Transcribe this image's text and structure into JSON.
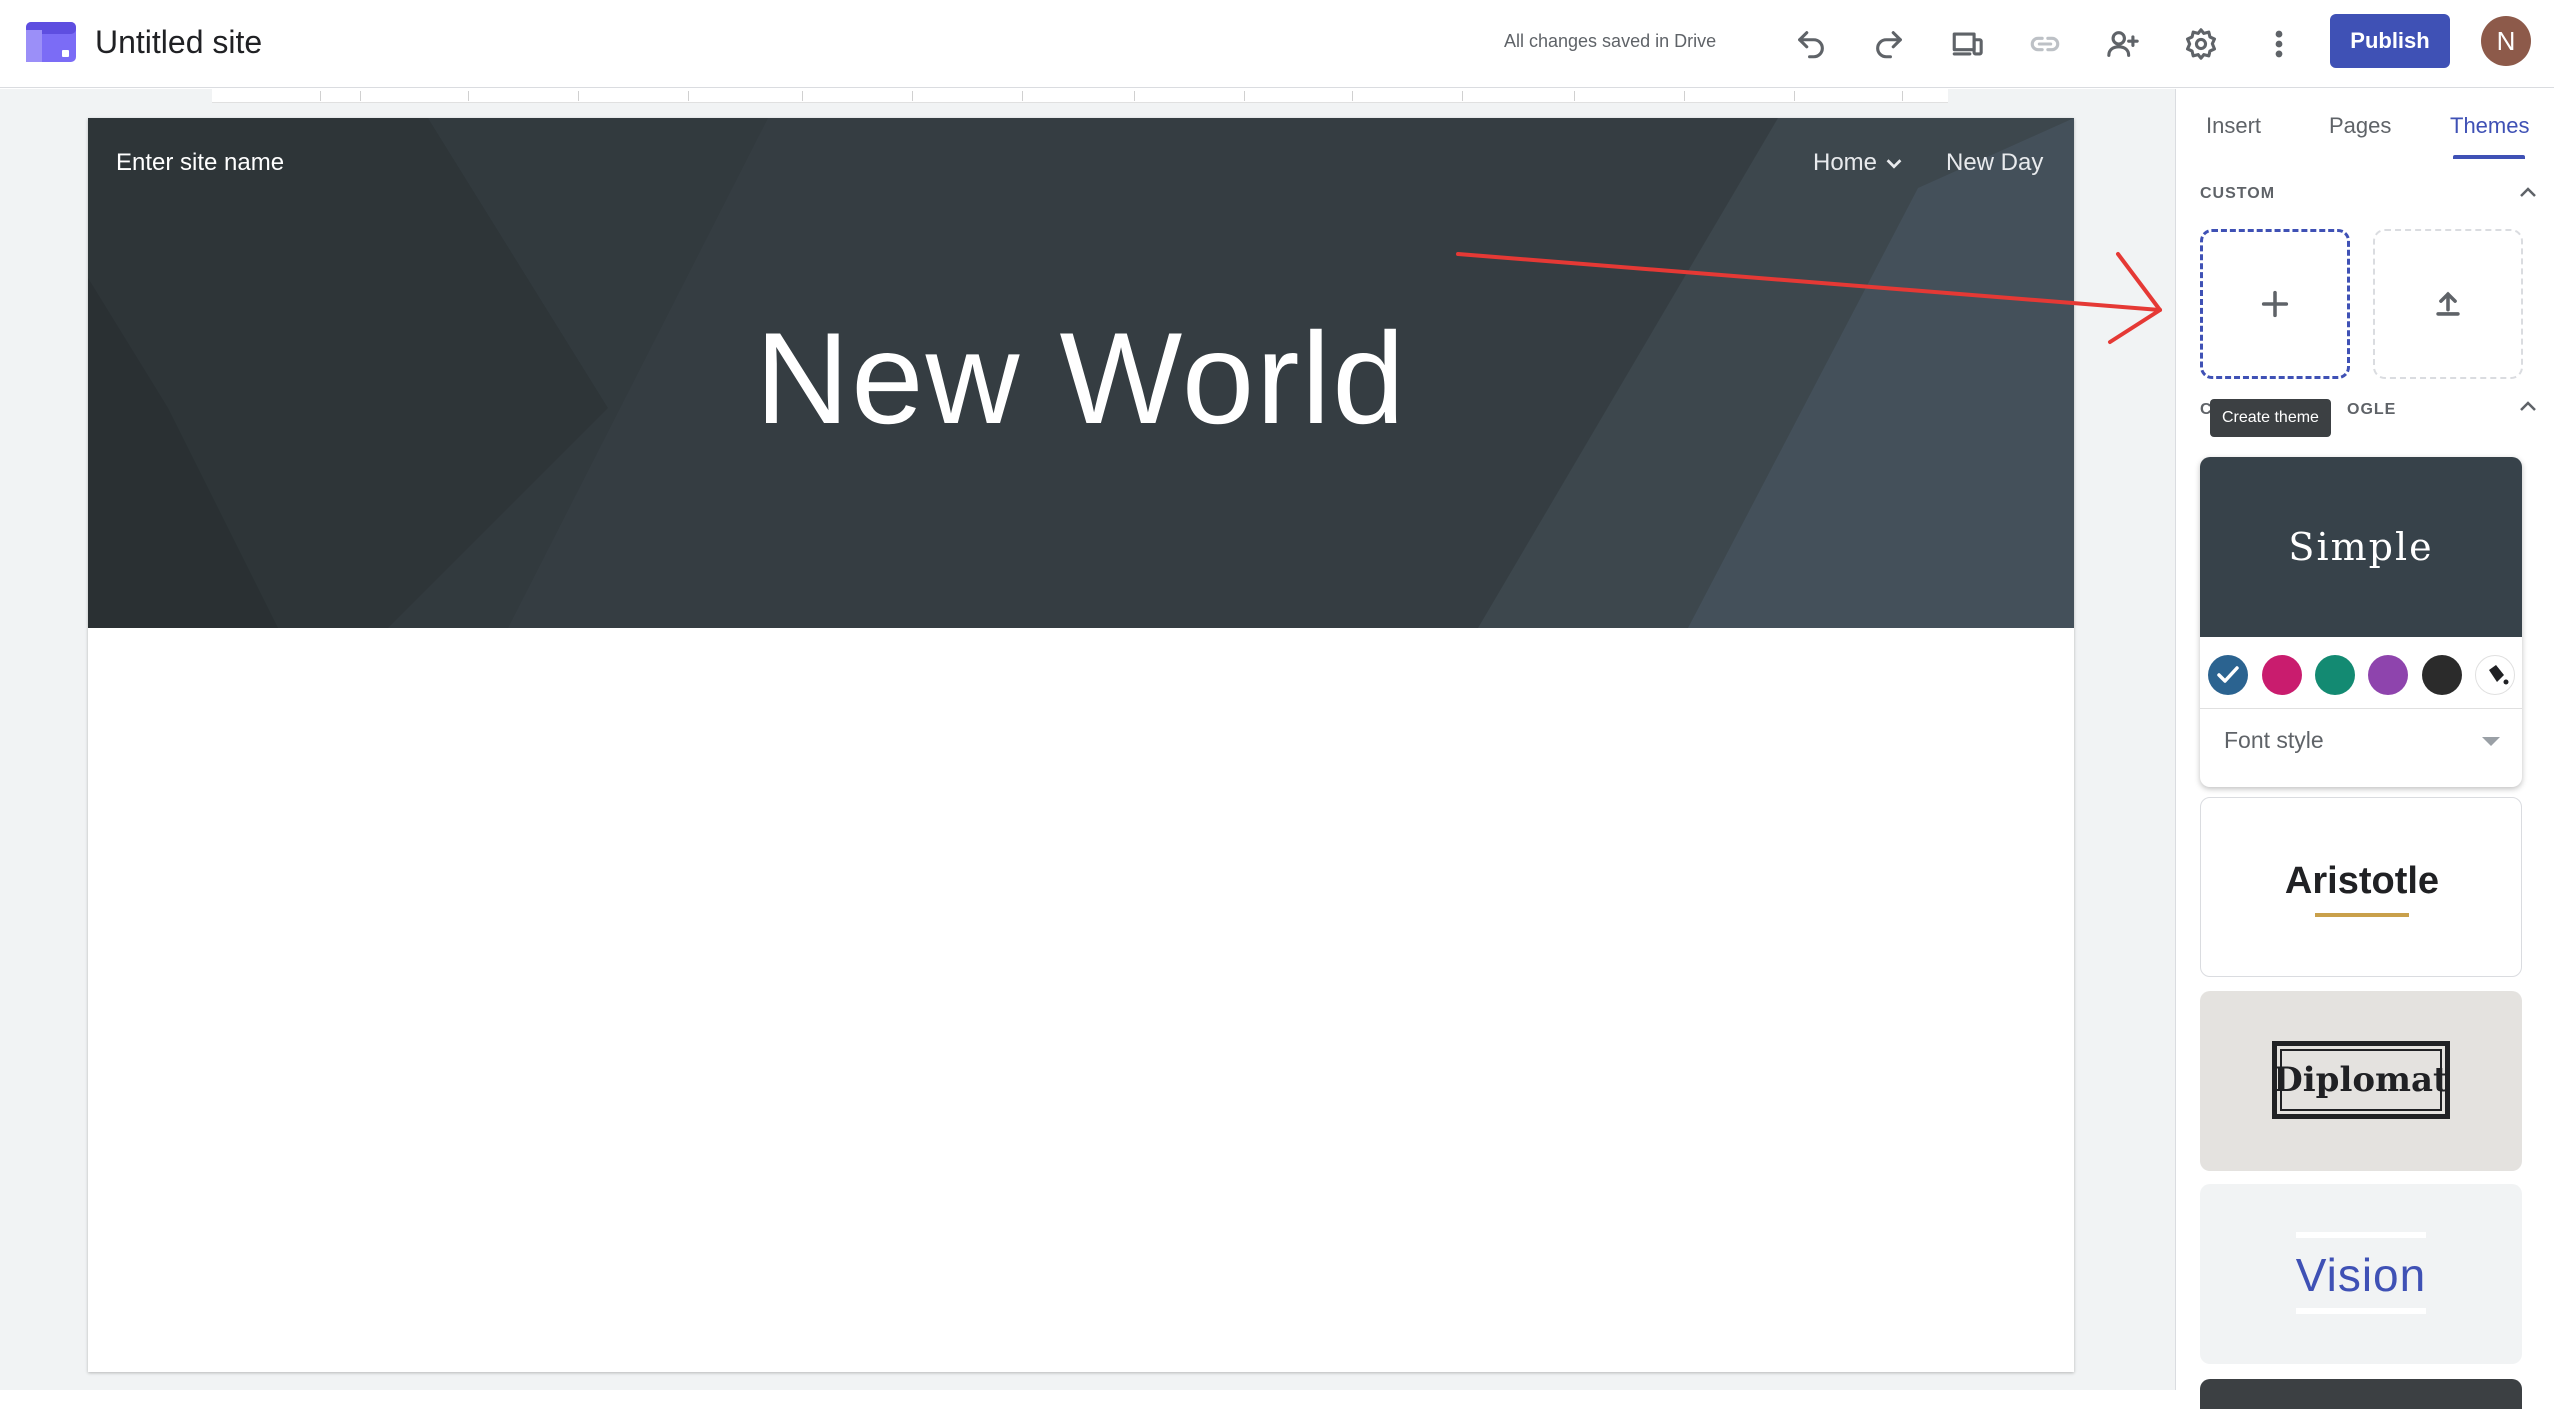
{
  "header": {
    "site_title": "Untitled site",
    "save_status": "All changes saved in Drive",
    "publish_label": "Publish",
    "avatar_initial": "N",
    "icons": [
      "undo-icon",
      "redo-icon",
      "preview-icon",
      "link-icon",
      "share-icon",
      "settings-icon",
      "more-icon"
    ]
  },
  "site": {
    "site_name_placeholder": "Enter site name",
    "nav": [
      {
        "label": "Home"
      },
      {
        "label": "New Day"
      }
    ],
    "hero_title": "New World"
  },
  "panel": {
    "tabs": [
      {
        "label": "Insert"
      },
      {
        "label": "Pages"
      },
      {
        "label": "Themes",
        "active": true
      }
    ],
    "custom_section_label": "CUSTOM",
    "google_section_label_visible": "C",
    "google_section_label_tail": "OGLE",
    "tooltip": "Create theme",
    "themes": [
      {
        "name": "Simple",
        "colors": [
          "#2b6390",
          "#c91c6e",
          "#138a72",
          "#8e44ad",
          "#2b2b2b"
        ],
        "font_style_label": "Font style"
      },
      {
        "name": "Aristotle"
      },
      {
        "name": "Diplomat"
      },
      {
        "name": "Vision"
      }
    ]
  },
  "colors": {
    "accent": "#3f51b5",
    "header_bg": "#353d42",
    "annotation_arrow": "#e53935"
  }
}
